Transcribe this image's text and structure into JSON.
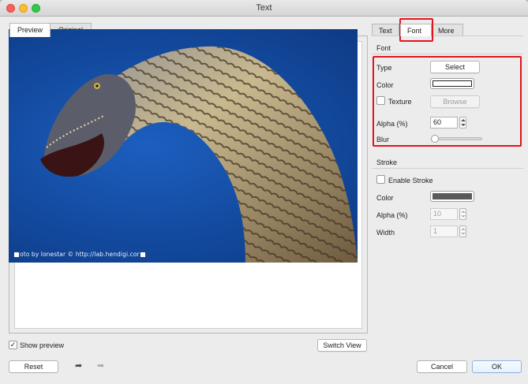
{
  "window": {
    "title": "Text"
  },
  "left_tabs": [
    {
      "label": "Preview"
    },
    {
      "label": "Original"
    }
  ],
  "photo": {
    "watermark": "oto by lonestar © http://lab.hendigi.cor",
    "colors": {
      "sky": "#134a9f",
      "neck_light": "#c9b98f",
      "neck_dark": "#4a3e2c"
    }
  },
  "show_preview": {
    "label": "Show preview",
    "checked": true
  },
  "switch_view": {
    "label": "Switch View"
  },
  "reset": {
    "label": "Reset"
  },
  "undo_icon": "undo-arrow",
  "redo_icon": "redo-arrow",
  "right_tabs": [
    {
      "label": "Text"
    },
    {
      "label": "Font"
    },
    {
      "label": "More"
    }
  ],
  "font_section": {
    "title": "Font",
    "type_label": "Type",
    "select_label": "Select",
    "color_label": "Color",
    "color_value": "#ffffff",
    "texture_label": "Texture",
    "texture_checked": false,
    "browse_label": "Browse",
    "alpha_label": "Alpha (%)",
    "alpha_value": "60",
    "blur_label": "Blur",
    "blur_level": 0
  },
  "stroke_section": {
    "title": "Stroke",
    "enable_label": "Enable Stroke",
    "enable_checked": false,
    "color_label": "Color",
    "color_value": "#5a5a5a",
    "alpha_label": "Alpha (%)",
    "alpha_value": "10",
    "width_label": "Width",
    "width_value": "1"
  },
  "cancel": {
    "label": "Cancel"
  },
  "ok": {
    "label": "OK"
  },
  "highlight_color": "#e0141e"
}
